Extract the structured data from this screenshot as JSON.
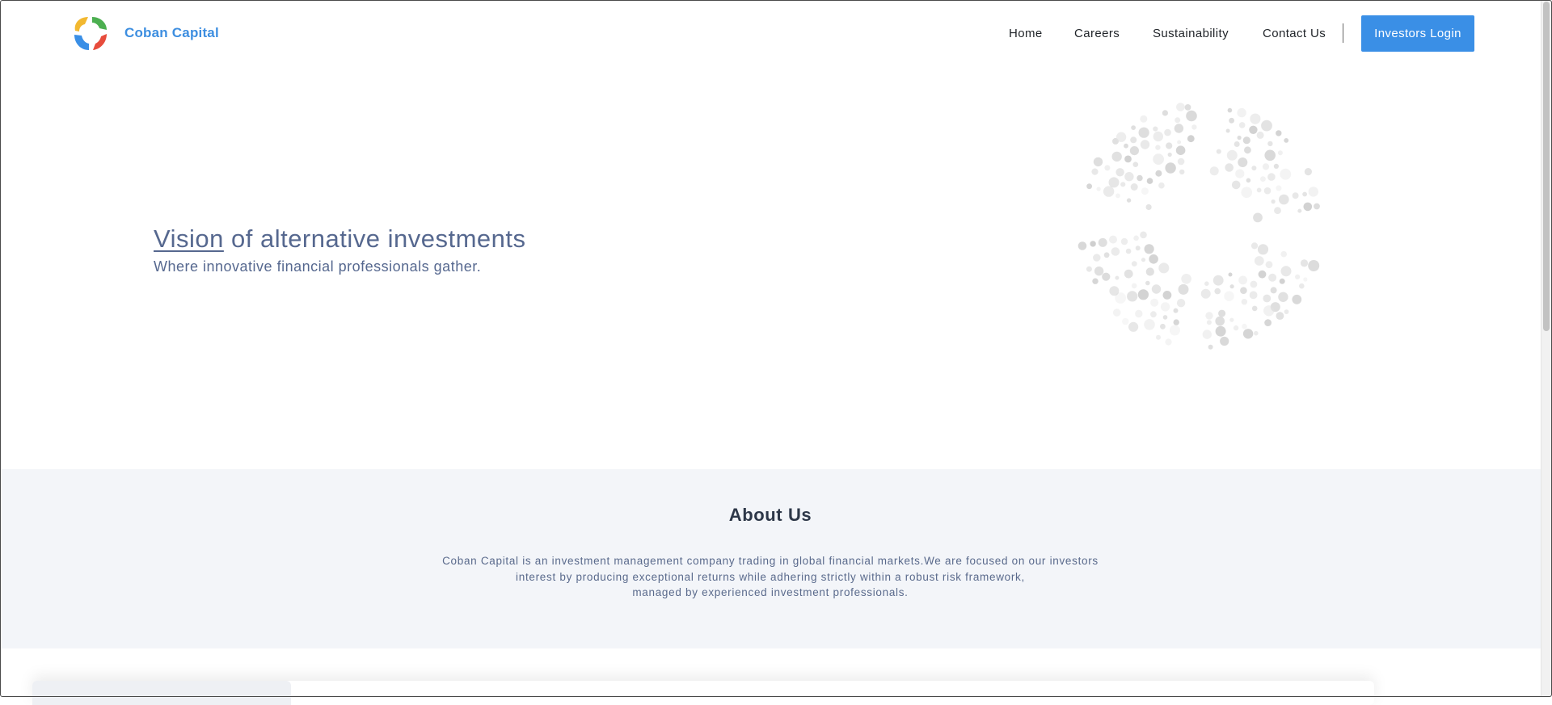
{
  "header": {
    "brand_name": "Coban Capital",
    "nav": [
      {
        "label": "Home",
        "name": "nav-home"
      },
      {
        "label": "Careers",
        "name": "nav-careers"
      },
      {
        "label": "Sustainability",
        "name": "nav-sustainability"
      },
      {
        "label": "Contact Us",
        "name": "nav-contact-us"
      }
    ],
    "login_label": "Investors Login"
  },
  "hero": {
    "title_highlight": "Vision",
    "title_rest": " of alternative investments",
    "subtitle": "Where innovative financial professionals gather."
  },
  "about": {
    "title": "About Us",
    "lines": [
      "Coban Capital is an investment management company trading in global financial markets.We are focused on our investors",
      "interest by producing exceptional returns while adhering strictly within a robust risk framework,",
      "managed by experienced investment professionals."
    ]
  },
  "colors": {
    "brand": "#3d8ee0",
    "button": "#3a8fe6",
    "hero_text": "#56688f",
    "about_bg": "#f3f5f9",
    "logo_segments": [
      "#f2b830",
      "#4caf50",
      "#3a8fe6",
      "#e74c3c"
    ]
  }
}
